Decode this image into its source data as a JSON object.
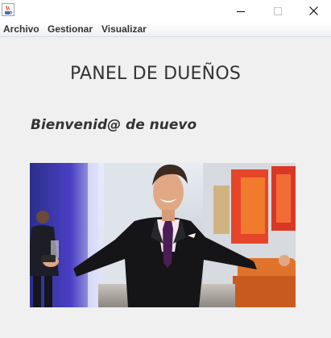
{
  "window": {
    "minimize_icon": "minimize-icon",
    "maximize_icon": "maximize-icon",
    "close_icon": "close-icon",
    "app_icon": "java-cup-icon"
  },
  "menubar": {
    "items": [
      {
        "label": "Archivo"
      },
      {
        "label": "Gestionar"
      },
      {
        "label": "Visualizar"
      }
    ]
  },
  "main": {
    "title": "PANEL DE DUEÑOS",
    "welcome": "Bienvenid@ de nuevo",
    "photo": "photo of a smiling man in a dark suit and purple tie with arms spread wide"
  },
  "colors": {
    "background": "#f0f0f0",
    "text": "#333333"
  }
}
